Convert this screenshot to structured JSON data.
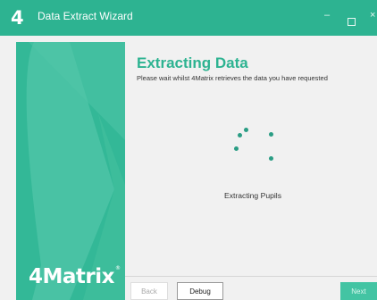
{
  "window": {
    "logo": "4",
    "title": "Data Extract Wizard",
    "minimize": "–",
    "close": "×"
  },
  "sidebar": {
    "brand": "4Matrix",
    "brand_mark": "®"
  },
  "main": {
    "heading": "Extracting Data",
    "subheading": "Please wait whilst 4Matrix retrieves the data you have requested",
    "status": "Extracting Pupils"
  },
  "buttons": {
    "back": "Back",
    "debug": "Debug",
    "next": "Next"
  },
  "colors": {
    "accent": "#2db391",
    "sidebar": "#33b897"
  }
}
